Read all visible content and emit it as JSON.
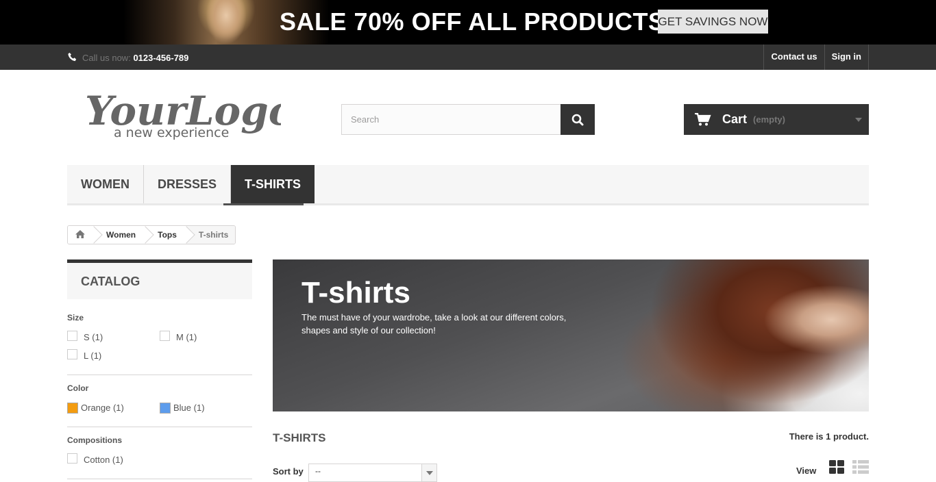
{
  "promo": {
    "headline": "SALE 70% OFF ALL PRODUCTS",
    "button_label": "GET SAVINGS NOW"
  },
  "topbar": {
    "call_label": "Call us now:",
    "phone": "0123-456-789",
    "links": [
      {
        "label": "Contact us",
        "icon": "none"
      },
      {
        "label": "Sign in",
        "icon": "none"
      }
    ]
  },
  "logo": {
    "text": "YourLogo",
    "tagline": "a new experience"
  },
  "search": {
    "placeholder": "Search",
    "icon": "search-icon"
  },
  "cart": {
    "label": "Cart",
    "status": "(empty)",
    "icon": "cart-icon"
  },
  "menu": {
    "items": [
      {
        "label": "Women",
        "active": false
      },
      {
        "label": "Dresses",
        "active": false
      },
      {
        "label": "T-shirts",
        "active": true
      }
    ]
  },
  "breadcrumb": {
    "home_icon": "home-icon",
    "items": [
      "Women",
      "Tops",
      "T-shirts"
    ]
  },
  "catalog": {
    "title": "Catalog",
    "facets": [
      {
        "title": "Size",
        "items": [
          {
            "label": "S (1)"
          },
          {
            "label": "M (1)"
          },
          {
            "label": "L (1)"
          }
        ]
      },
      {
        "title": "Color",
        "items": [
          {
            "label": "Orange (1)",
            "color": "#F39C11"
          },
          {
            "label": "Blue (1)",
            "color": "#5D9CEC"
          }
        ]
      },
      {
        "title": "Compositions",
        "items": [
          {
            "label": "Cotton (1)"
          }
        ]
      }
    ]
  },
  "category": {
    "title": "T-shirts",
    "description": "The must have of your wardrobe, take a look at our different colors, shapes and style of our collection!"
  },
  "products": {
    "heading": "T-SHIRTS",
    "count_text": "There is 1 product.",
    "sort_label": "Sort by",
    "sort_value": "--",
    "view_label": "View"
  },
  "colors": {
    "dark": "#333333",
    "promo_bg": "#000000",
    "menu_bg": "#F6F6F6"
  }
}
